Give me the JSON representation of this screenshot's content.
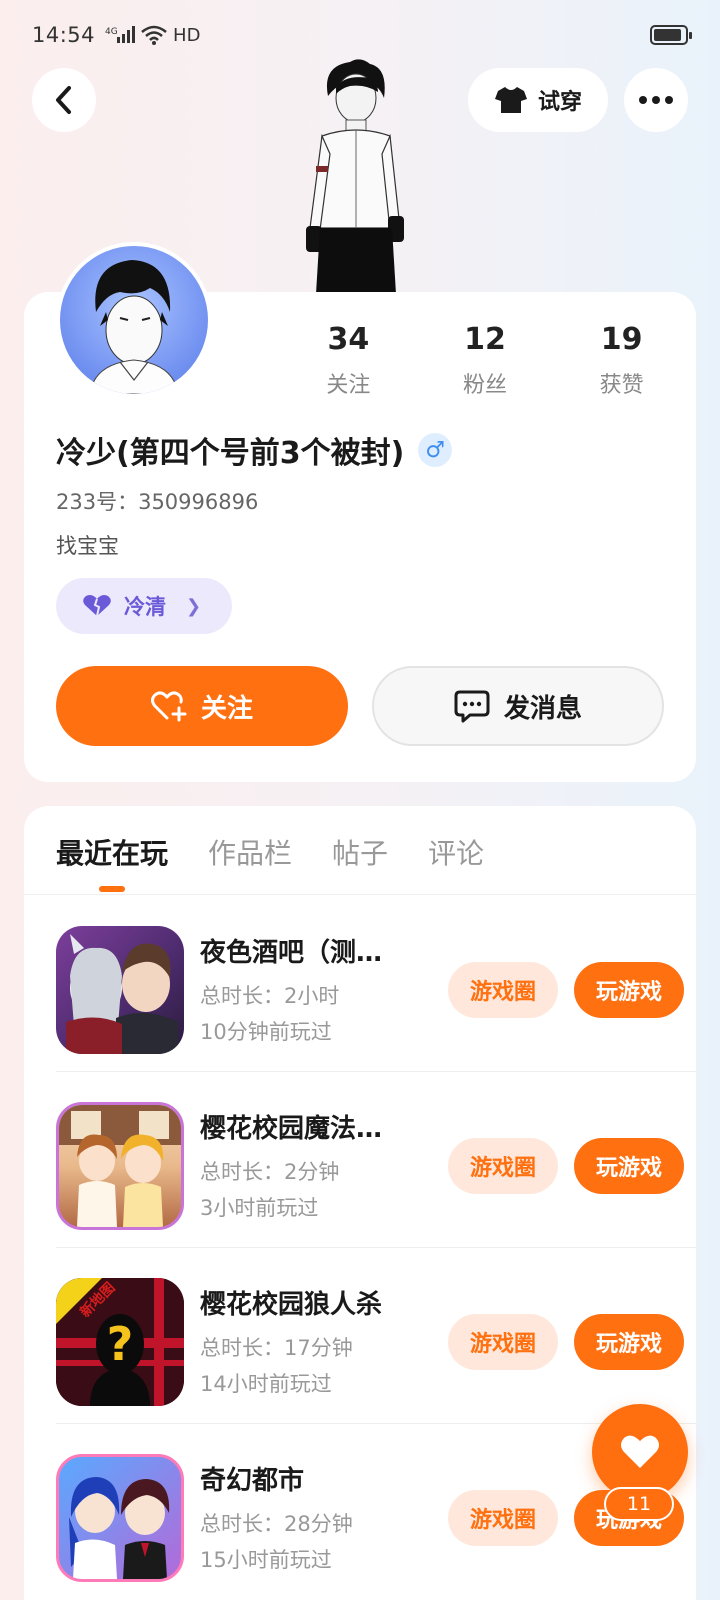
{
  "status_bar": {
    "time": "14:54",
    "network": "4G",
    "hd": "HD"
  },
  "header": {
    "try_on_label": "试穿"
  },
  "profile": {
    "stats": [
      {
        "num": "34",
        "label": "关注"
      },
      {
        "num": "12",
        "label": "粉丝"
      },
      {
        "num": "19",
        "label": "获赞"
      }
    ],
    "username": "冷少(第四个号前3个被封)",
    "gender": "♂",
    "uid": "233号：350996896",
    "bio": "找宝宝",
    "tag": "冷清",
    "follow_label": "关注",
    "message_label": "发消息"
  },
  "tabs": [
    "最近在玩",
    "作品栏",
    "帖子",
    "评论"
  ],
  "games": [
    {
      "title": "夜色酒吧（测试）",
      "duration": "总时长：2小时",
      "last_played": "10分钟前玩过",
      "circle": "游戏圈",
      "play": "玩游戏"
    },
    {
      "title": " 樱花校园魔法世界",
      "duration": "总时长：2分钟",
      "last_played": "3小时前玩过",
      "circle": "游戏圈",
      "play": "玩游戏"
    },
    {
      "title": "樱花校园狼人杀",
      "duration": "总时长：17分钟",
      "last_played": "14小时前玩过",
      "circle": "游戏圈",
      "play": "玩游戏",
      "badge": "新地图"
    },
    {
      "title": "奇幻都市",
      "duration": "总时长：28分钟",
      "last_played": "15小时前玩过",
      "circle": "游戏圈",
      "play": "玩游戏"
    }
  ],
  "fab": {
    "count": "11"
  },
  "colors": {
    "accent": "#ff7011",
    "tag_bg": "#ece9fc",
    "tag_fg": "#6a5ad8"
  }
}
